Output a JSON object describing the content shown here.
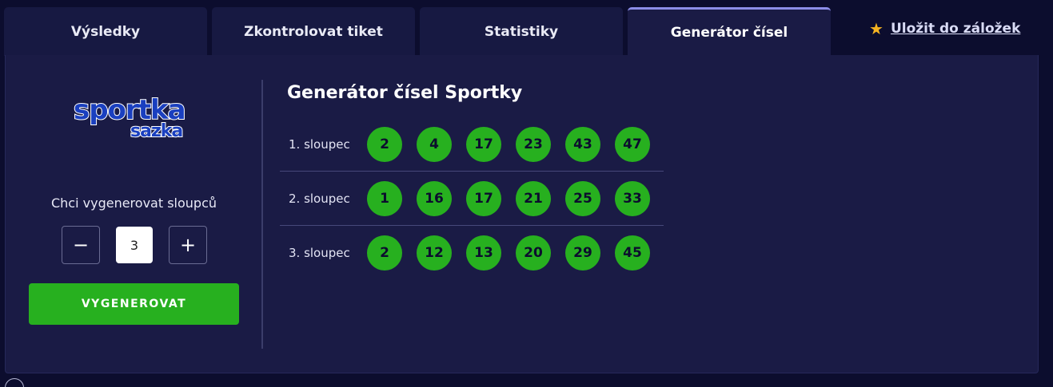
{
  "tabs": [
    {
      "label": "Výsledky"
    },
    {
      "label": "Zkontrolovat tiket"
    },
    {
      "label": "Statistiky"
    },
    {
      "label": "Generátor čísel"
    }
  ],
  "active_tab": "Generátor čísel",
  "bookmark": {
    "label": "Uložit do záložek",
    "icon": "star-icon"
  },
  "logo": {
    "line1": "sportka",
    "line2": "sazka"
  },
  "generator": {
    "columns_label": "Chci vygenerovat sloupců",
    "minus": "−",
    "plus": "+",
    "count": "3",
    "button_label": "VYGENEROVAT"
  },
  "results": {
    "title": "Generátor čísel Sportky",
    "rows": [
      {
        "label": "1. sloupec",
        "numbers": [
          "2",
          "4",
          "17",
          "23",
          "43",
          "47"
        ]
      },
      {
        "label": "2. sloupec",
        "numbers": [
          "1",
          "16",
          "17",
          "21",
          "25",
          "33"
        ]
      },
      {
        "label": "3. sloupec",
        "numbers": [
          "2",
          "12",
          "13",
          "20",
          "29",
          "45"
        ]
      }
    ]
  },
  "colors": {
    "background": "#0c0d2e",
    "panel": "#1a1b45",
    "accent_green": "#27b01f",
    "active_tab_border": "#8c8de8",
    "star": "#f5b321"
  }
}
